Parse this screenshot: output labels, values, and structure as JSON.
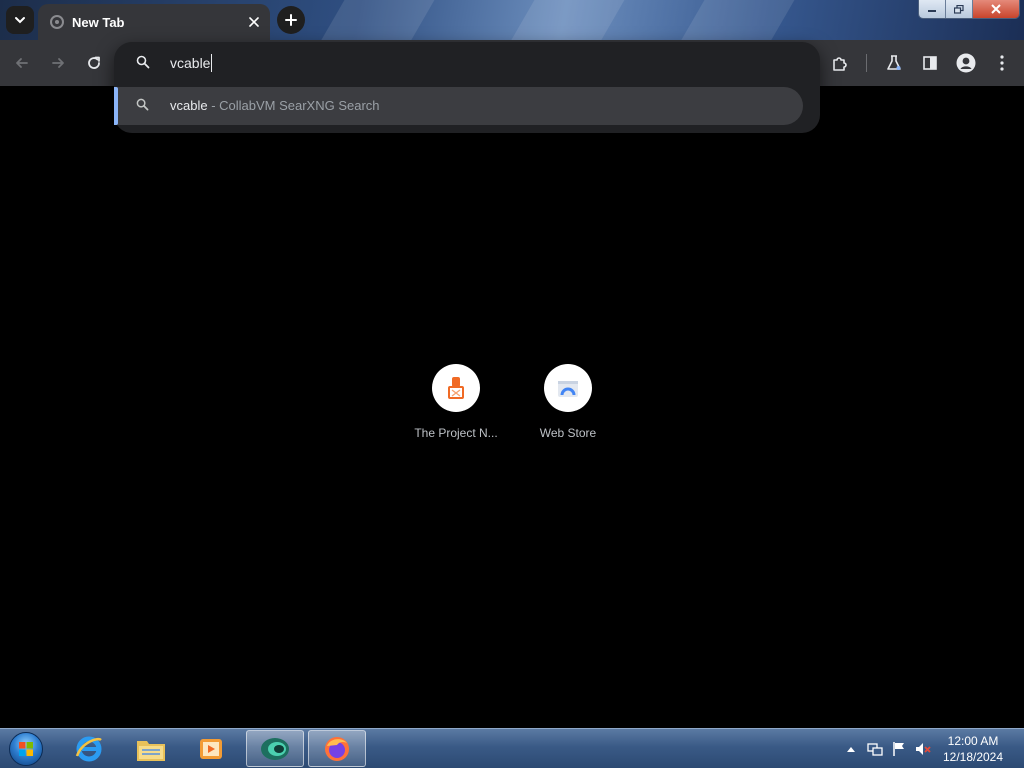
{
  "browser": {
    "tab": {
      "title": "New Tab",
      "icon": "globe-icon"
    },
    "buttons": {
      "tab_search": "chevron-down-icon",
      "new_tab": "plus-icon",
      "back": "arrow-left-icon",
      "forward": "arrow-right-icon",
      "reload": "reload-icon",
      "extensions": "puzzle-icon",
      "labs": "flask-icon",
      "side_panel": "side-panel-icon",
      "profile": "profile-icon",
      "menu": "kebab-menu-icon"
    },
    "window_controls": [
      "minimize",
      "restore",
      "close"
    ]
  },
  "omnibox": {
    "value": "vcable",
    "suggestions": [
      {
        "query": "vcable",
        "suffix": " - CollabVM SearXNG Search",
        "icon": "search-icon"
      }
    ]
  },
  "ntp": {
    "shortcuts": [
      {
        "label": "The Project N...",
        "icon": "project-nayuki-icon",
        "color": "#f06a25"
      },
      {
        "label": "Web Store",
        "icon": "web-store-icon",
        "color": "#4285f4"
      }
    ]
  },
  "taskbar": {
    "apps": [
      {
        "name": "internet-explorer",
        "active": false
      },
      {
        "name": "file-explorer",
        "active": false
      },
      {
        "name": "media-player",
        "active": false
      },
      {
        "name": "chrome-like-browser",
        "active": true
      },
      {
        "name": "firefox",
        "active": false
      }
    ],
    "clock": {
      "time": "12:00 AM",
      "date": "12/18/2024"
    }
  },
  "colors": {
    "accent": "#8ab4f8",
    "toolbar": "#35363a",
    "omnibox": "#202124",
    "suggestion_highlight": "#3c3d41"
  }
}
